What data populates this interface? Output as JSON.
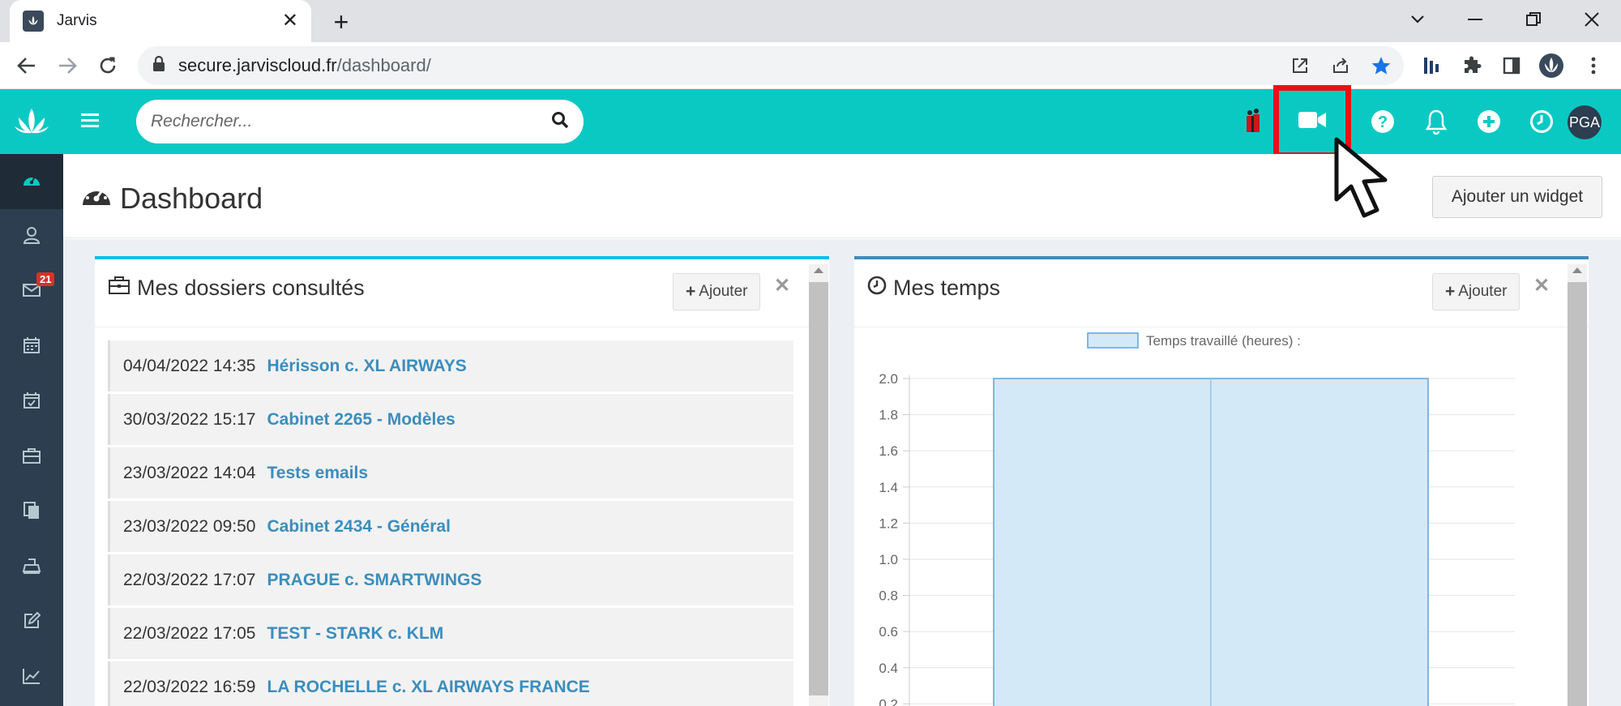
{
  "browser": {
    "tab_title": "Jarvis",
    "url_host": "secure.jarviscloud.fr",
    "url_path": "/dashboard/"
  },
  "app": {
    "accent_color": "#0ac9c3",
    "sidebar_color": "#2c3e50",
    "search_placeholder": "Rechercher...",
    "avatar_initials": "PGA",
    "sidebar_items": [
      {
        "name": "dashboard",
        "icon": "dashboard-icon",
        "active": true
      },
      {
        "name": "contacts",
        "icon": "user-icon"
      },
      {
        "name": "mail",
        "icon": "envelope-icon",
        "badge": "21"
      },
      {
        "name": "calendar",
        "icon": "calendar-icon"
      },
      {
        "name": "tasks",
        "icon": "calendar-check-icon"
      },
      {
        "name": "dossiers",
        "icon": "briefcase-icon"
      },
      {
        "name": "documents",
        "icon": "copy-icon"
      },
      {
        "name": "billing",
        "icon": "cash-register-icon"
      },
      {
        "name": "edit",
        "icon": "edit-icon"
      },
      {
        "name": "stats",
        "icon": "line-chart-icon"
      }
    ]
  },
  "page": {
    "title": "Dashboard",
    "add_widget_label": "Ajouter un widget"
  },
  "widgets": {
    "dossiers": {
      "title": "Mes dossiers consultés",
      "add_label": "Ajouter",
      "items": [
        {
          "date": "04/04/2022 14:35",
          "name": "Hérisson c. XL AIRWAYS"
        },
        {
          "date": "30/03/2022 15:17",
          "name": "Cabinet 2265 - Modèles"
        },
        {
          "date": "23/03/2022 14:04",
          "name": "Tests emails"
        },
        {
          "date": "23/03/2022 09:50",
          "name": "Cabinet 2434 - Général"
        },
        {
          "date": "22/03/2022 17:07",
          "name": "PRAGUE c. SMARTWINGS"
        },
        {
          "date": "22/03/2022 17:05",
          "name": "TEST - STARK c. KLM"
        },
        {
          "date": "22/03/2022 16:59",
          "name": "LA ROCHELLE c. XL AIRWAYS FRANCE"
        }
      ]
    },
    "temps": {
      "title": "Mes temps",
      "add_label": "Ajouter"
    }
  },
  "chart_data": {
    "type": "bar",
    "series": [
      {
        "name": "Temps travaillé (heures) :",
        "values": [
          2.0,
          2.0
        ]
      }
    ],
    "yticks": [
      "2.0",
      "1.8",
      "1.6",
      "1.4",
      "1.2",
      "1.0",
      "0.8",
      "0.6",
      "0.4",
      "0.2"
    ],
    "ylim": [
      0,
      2.0
    ],
    "legend_position": "top",
    "bar_color": "#d4e9f8",
    "bar_border_color": "#5aa3de",
    "grid": true
  }
}
